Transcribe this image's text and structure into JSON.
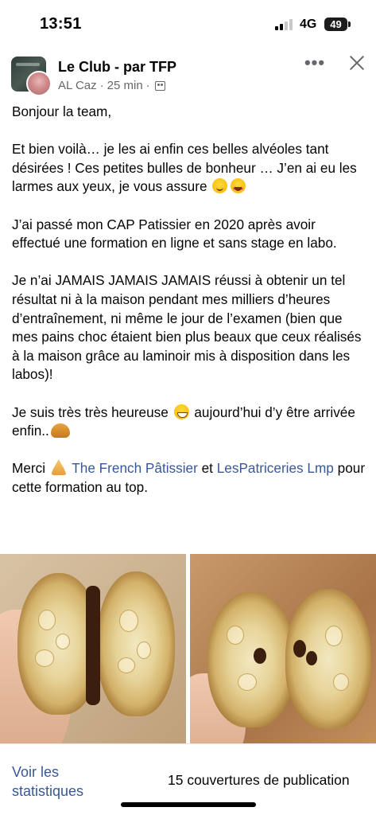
{
  "status_bar": {
    "time": "13:51",
    "network": "4G",
    "battery": "49"
  },
  "post": {
    "group_name": "Le Club - par TFP",
    "author": "AL Caz",
    "separator": "·",
    "time_ago": "25 min",
    "audience_icon": "group-icon",
    "paragraphs": {
      "p1": "Bonjour la team,",
      "p2a": "Et bien voilà… je les ai enfin ces belles alvéoles tant désirées ! Ces petites bulles de bonheur … J’en ai eu les larmes aux yeux, je vous assure",
      "p3": "J’ai passé mon CAP Patissier en 2020 après avoir effectué une formation en ligne et sans stage en labo.",
      "p4": "Je n’ai JAMAIS JAMAIS JAMAIS réussi à obtenir un tel résultat ni à la maison pendant mes milliers d’heures d’entraînement, ni même le jour de l’examen (bien que mes pains choc étaient bien plus beaux que ceux réalisés à la maison grâce au laminoir mis à disposition dans les labos)!",
      "p5a": "Je suis très très heureuse",
      "p5b": "aujourd’hui d’y être arrivée enfin..",
      "p6a": "Merci",
      "p6_link1": "The French Pâtissier",
      "p6_and": "et",
      "p6_link2": "LesPatriceries Lmp",
      "p6b": "pour cette formation au top."
    }
  },
  "footer": {
    "stats_label": "Voir les statistiques",
    "coverage_label": "15 couvertures de publication"
  },
  "colors": {
    "link": "#385898",
    "meta": "#65676b",
    "text": "#050505"
  }
}
